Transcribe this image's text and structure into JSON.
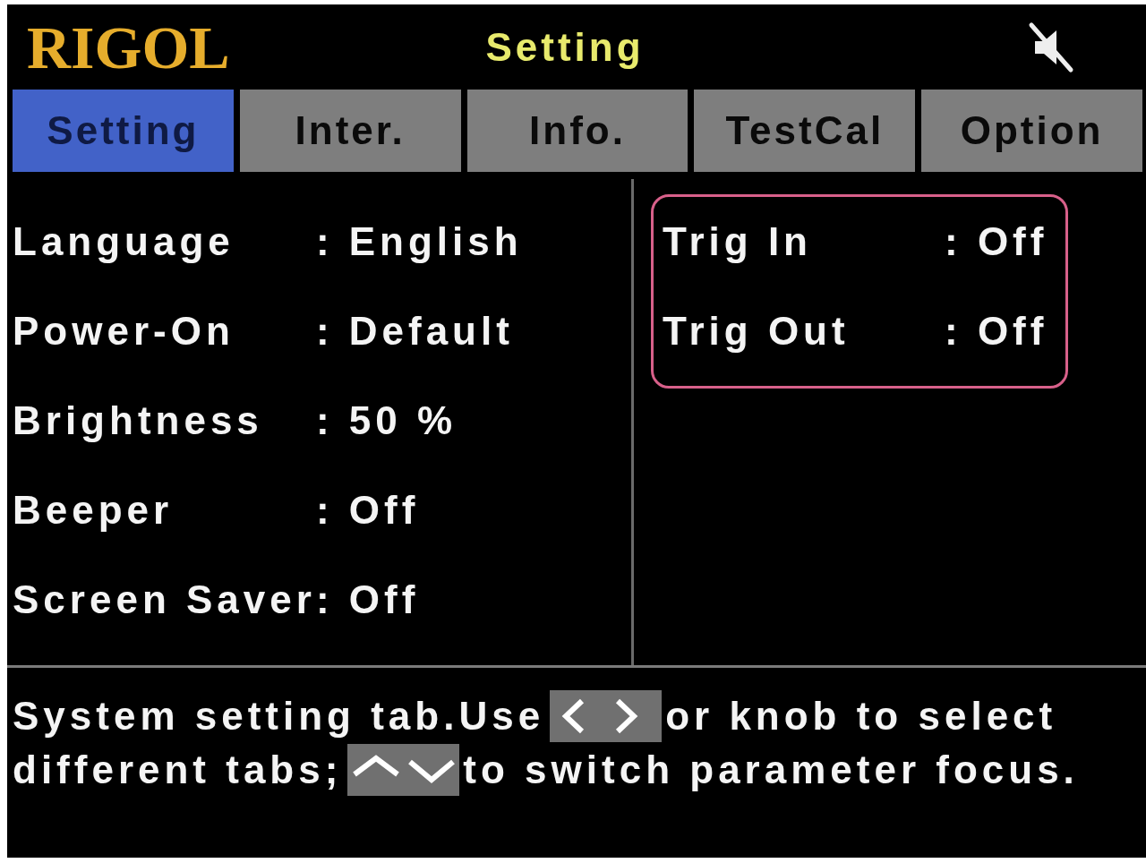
{
  "header": {
    "logo": "RIGOL",
    "title": "Setting"
  },
  "tabs": [
    {
      "label": "Setting",
      "selected": true
    },
    {
      "label": "Inter.",
      "selected": false
    },
    {
      "label": "Info.",
      "selected": false
    },
    {
      "label": "TestCal",
      "selected": false
    },
    {
      "label": "Option",
      "selected": false
    }
  ],
  "settings": [
    {
      "label": "Language",
      "value": ": English"
    },
    {
      "label": "Power-On",
      "value": ": Default"
    },
    {
      "label": "Brightness",
      "value": ": 50 %"
    },
    {
      "label": "Beeper",
      "value": ": Off"
    },
    {
      "label": "Screen Saver",
      "value": ": Off"
    }
  ],
  "trigger_group": {
    "focused": true,
    "items": [
      {
        "label": "Trig In",
        "value": ": Off"
      },
      {
        "label": "Trig Out",
        "value": ": Off"
      }
    ]
  },
  "hint": {
    "lines": [
      [
        {
          "kind": "text",
          "text": "System setting tab.Use"
        },
        {
          "kind": "left_right_keys"
        },
        {
          "kind": "text",
          "text": "or knob to select"
        }
      ],
      [
        {
          "kind": "text",
          "text": "different tabs;"
        },
        {
          "kind": "up_down_keys"
        },
        {
          "kind": "text",
          "text": "to switch parameter focus."
        }
      ]
    ]
  }
}
